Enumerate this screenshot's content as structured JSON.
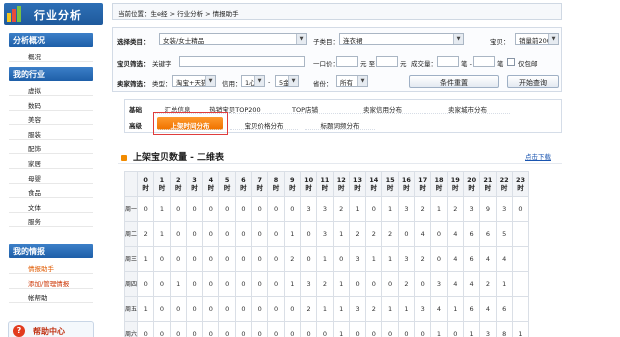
{
  "sidebar": {
    "logo_title": "行业分析",
    "sections": [
      {
        "title": "分析概况",
        "items": [
          {
            "label": "概况"
          }
        ]
      },
      {
        "title": "我的行业",
        "items": [
          {
            "label": "虚拟"
          },
          {
            "label": "数码"
          },
          {
            "label": "美容"
          },
          {
            "label": "服装"
          },
          {
            "label": "配饰"
          },
          {
            "label": "家居"
          },
          {
            "label": "母婴"
          },
          {
            "label": "食品"
          },
          {
            "label": "文体"
          },
          {
            "label": "服务"
          }
        ]
      },
      {
        "title": "我的情报",
        "items": [
          {
            "label": "情报助手"
          },
          {
            "label": "添加/管理情报"
          },
          {
            "label": "帐帮助"
          }
        ]
      }
    ],
    "help_label": "帮助中心"
  },
  "breadcrumb": "当前位置：生e经 > 行业分析 > 情报助手",
  "filters": {
    "category_label": "选择类目：",
    "category_value": "女装/女士精品",
    "subcategory_label": "子类目：",
    "subcategory_value": "连衣裙",
    "item_filter_label": "宝贝：",
    "item_filter_value": "销量前200",
    "product_filter_label": "宝贝筛选：",
    "keyword_label": "关键字",
    "price_label": "一口价：",
    "price_to": "元 至",
    "price_unit": "元",
    "deal_label": "成交量：",
    "deal_to": "笔 -",
    "deal_unit": "笔",
    "exclude_label": "仅包邮",
    "seller_filter_label": "卖家筛选：",
    "type_label": "类型：",
    "type_value": "淘宝+天猫",
    "credit_label": "信用：",
    "credit_from": "1心",
    "credit_sep": "-",
    "credit_to": "5金",
    "province_label": "省份：",
    "province_value": "所有",
    "reset_button": "条件重置",
    "query_button": "开始查询"
  },
  "tabs": {
    "row1_label": "基础",
    "row1": [
      "汇总信息",
      "热销宝贝TOP200",
      "TOP店铺",
      "卖家信用分布",
      "卖家城市分布"
    ],
    "row2_label": "高级",
    "row2": [
      "上架时间分布",
      "宝贝价格分布",
      "标题词频分布"
    ],
    "active": "上架时间分布"
  },
  "section": {
    "title": "上架宝贝数量 - 二维表",
    "download_label": "点击下载"
  },
  "table": {
    "hour_unit": "时",
    "hours": [
      "0",
      "1",
      "2",
      "3",
      "4",
      "5",
      "6",
      "7",
      "8",
      "9",
      "10",
      "11",
      "12",
      "13",
      "14",
      "15",
      "16",
      "17",
      "18",
      "19",
      "20",
      "21",
      "22",
      "23"
    ],
    "rows": [
      {
        "day": "周一",
        "values": [
          "0",
          "1",
          "0",
          "0",
          "0",
          "0",
          "0",
          "0",
          "0",
          "0",
          "3",
          "3",
          "2",
          "1",
          "0",
          "1",
          "3",
          "2",
          "1",
          "2",
          "3",
          "9",
          "3",
          "0"
        ]
      },
      {
        "day": "周二",
        "values": [
          "2",
          "1",
          "0",
          "0",
          "0",
          "0",
          "0",
          "0",
          "0",
          "1",
          "0",
          "3",
          "1",
          "2",
          "2",
          "2",
          "0",
          "4",
          "0",
          "4",
          "6",
          "6",
          "5",
          ""
        ]
      },
      {
        "day": "周三",
        "values": [
          "1",
          "0",
          "0",
          "0",
          "0",
          "0",
          "0",
          "0",
          "0",
          "2",
          "0",
          "1",
          "0",
          "3",
          "1",
          "1",
          "3",
          "2",
          "0",
          "4",
          "6",
          "4",
          "4",
          ""
        ]
      },
      {
        "day": "周四",
        "values": [
          "0",
          "0",
          "1",
          "0",
          "0",
          "0",
          "0",
          "0",
          "0",
          "1",
          "3",
          "2",
          "1",
          "0",
          "0",
          "0",
          "2",
          "0",
          "3",
          "4",
          "4",
          "2",
          "1",
          ""
        ]
      },
      {
        "day": "周五",
        "values": [
          "1",
          "0",
          "0",
          "0",
          "0",
          "0",
          "0",
          "0",
          "0",
          "0",
          "2",
          "1",
          "1",
          "3",
          "2",
          "1",
          "1",
          "3",
          "4",
          "1",
          "6",
          "4",
          "6",
          ""
        ]
      },
      {
        "day": "周六",
        "values": [
          "0",
          "0",
          "0",
          "0",
          "0",
          "0",
          "0",
          "0",
          "0",
          "0",
          "0",
          "0",
          "1",
          "0",
          "0",
          "0",
          "0",
          "0",
          "1",
          "0",
          "1",
          "3",
          "8",
          "1"
        ]
      }
    ]
  },
  "colors": {
    "sidebar_header": "#1e5fa8",
    "active_tab": "#f07400",
    "highlight_box": "#e03c3c",
    "link": "#1a55b0"
  }
}
